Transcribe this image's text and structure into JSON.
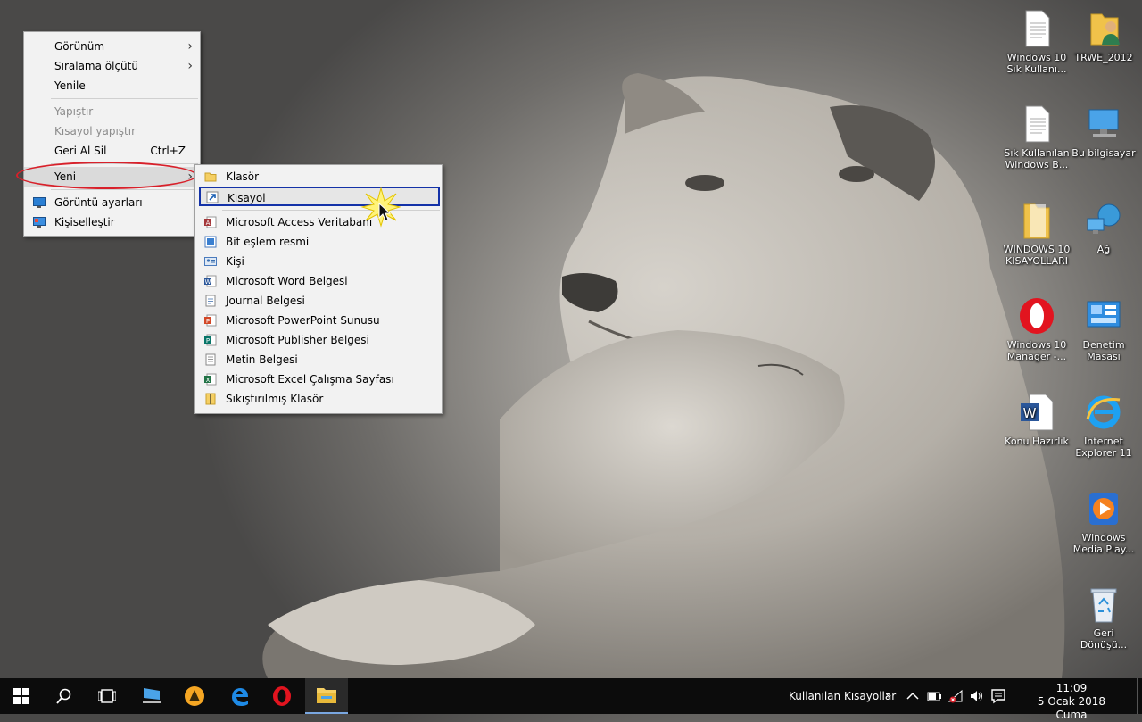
{
  "context_menu": {
    "items": [
      {
        "label": "Görünüm",
        "has_submenu": true
      },
      {
        "label": "Sıralama ölçütü",
        "has_submenu": true
      },
      {
        "label": "Yenile"
      },
      {
        "label": "Yapıştır",
        "disabled": true
      },
      {
        "label": "Kısayol yapıştır",
        "disabled": true
      },
      {
        "label": "Geri Al Sil",
        "shortcut": "Ctrl+Z"
      },
      {
        "label": "Yeni",
        "has_submenu": true,
        "highlighted": true
      },
      {
        "label": "Görüntü ayarları"
      },
      {
        "label": "Kişiselleştir"
      }
    ]
  },
  "new_submenu": {
    "items": [
      {
        "label": "Klasör",
        "icon": "folder-icon"
      },
      {
        "label": "Kısayol",
        "icon": "shortcut-icon",
        "highlighted": true
      },
      {
        "label": "Microsoft Access Veritabanı",
        "icon": "access-icon"
      },
      {
        "label": "Bit eşlem resmi",
        "icon": "bitmap-icon"
      },
      {
        "label": "Kişi",
        "icon": "contact-icon"
      },
      {
        "label": "Microsoft Word Belgesi",
        "icon": "word-icon"
      },
      {
        "label": "Journal Belgesi",
        "icon": "journal-icon"
      },
      {
        "label": "Microsoft PowerPoint Sunusu",
        "icon": "powerpoint-icon"
      },
      {
        "label": "Microsoft Publisher Belgesi",
        "icon": "publisher-icon"
      },
      {
        "label": "Metin Belgesi",
        "icon": "text-document-icon"
      },
      {
        "label": "Microsoft Excel Çalışma Sayfası",
        "icon": "excel-icon"
      },
      {
        "label": "Sıkıştırılmış Klasör",
        "icon": "zip-folder-icon"
      }
    ]
  },
  "desktop_icons": [
    {
      "label": "Windows 10 Sık Kullanı...",
      "icon": "document-icon"
    },
    {
      "label": "TRWE_2012",
      "icon": "user-folder-icon"
    },
    {
      "label": "Sık Kullanılan Windows B...",
      "icon": "document-icon"
    },
    {
      "label": "Bu bilgisayar",
      "icon": "computer-icon"
    },
    {
      "label": "WINDOWS 10 KISAYOLLARI",
      "icon": "folder-icon"
    },
    {
      "label": "Ağ",
      "icon": "network-icon"
    },
    {
      "label": "Windows 10 Manager -...",
      "icon": "opera-icon"
    },
    {
      "label": "Denetim Masası",
      "icon": "control-panel-icon"
    },
    {
      "label": "Konu Hazırlık",
      "icon": "word-document-icon"
    },
    {
      "label": "Internet Explorer 11",
      "icon": "internet-explorer-icon"
    },
    {
      "label": "Windows Media Play...",
      "icon": "media-player-icon"
    },
    {
      "label": "Geri Dönüşü...",
      "icon": "recycle-bin-icon"
    }
  ],
  "taskbar": {
    "apps": [
      "start-icon",
      "search-icon",
      "task-view-icon",
      "this-pc-icon",
      "app-icon",
      "edge-icon",
      "opera-icon",
      "file-explorer-icon"
    ],
    "toolbar_label": "Kullanılan Kısayollar",
    "time": "11:09",
    "date": "5 Ocak 2018 Cuma"
  },
  "colors": {
    "highlight_ellipse": "#d8202a",
    "selected_border": "#1432a8",
    "taskbar": "#0c0c0c",
    "menu_background": "#f2f2f2"
  }
}
